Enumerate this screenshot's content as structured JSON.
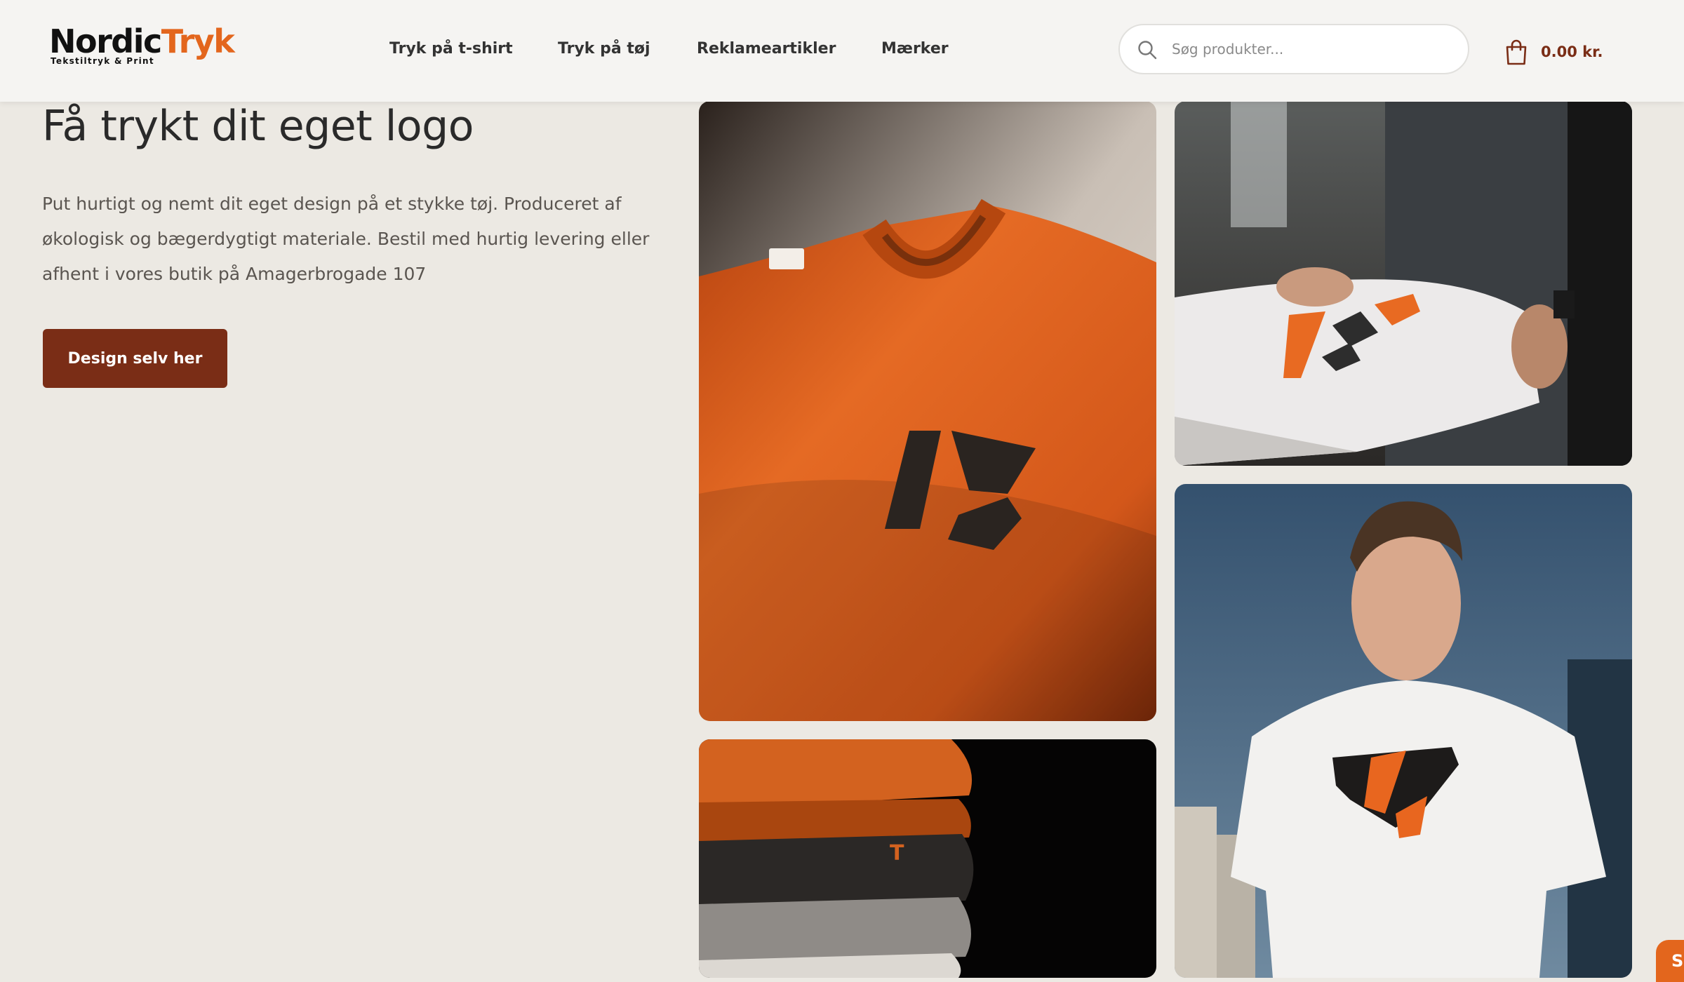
{
  "header": {
    "logo": {
      "name_part1": "Nordic",
      "name_part2": "Tryk",
      "tagline": "Tekstiltryk & Print"
    },
    "nav": [
      {
        "label": "Tryk på t-shirt"
      },
      {
        "label": "Tryk på tøj"
      },
      {
        "label": "Reklameartikler"
      },
      {
        "label": "Mærker"
      }
    ],
    "search": {
      "placeholder": "Søg produkter...",
      "value": "",
      "icon": "search-icon"
    },
    "cart": {
      "icon": "shopping-bag-icon",
      "total": "0.00 kr."
    }
  },
  "hero": {
    "title": "Få trykt dit eget logo",
    "description": "Put hurtigt og nemt dit eget design på et stykke tøj. Produceret af økologisk og bægerdygtigt materiale. Bestil med hurtig levering eller afhent i vores butik på Amagerbrogade 107",
    "cta_label": "Design selv her"
  },
  "gallery": [
    {
      "subject": "orange-tshirt-closeup"
    },
    {
      "subject": "white-tshirt-held"
    },
    {
      "subject": "folded-sweaters"
    },
    {
      "subject": "man-white-tshirt"
    }
  ],
  "chat": {
    "label": "S"
  },
  "colors": {
    "brand_dark": "#7a2d16",
    "brand_orange": "#e3661d",
    "page_bg": "#ece9e3",
    "header_bg": "#f5f4f2"
  }
}
